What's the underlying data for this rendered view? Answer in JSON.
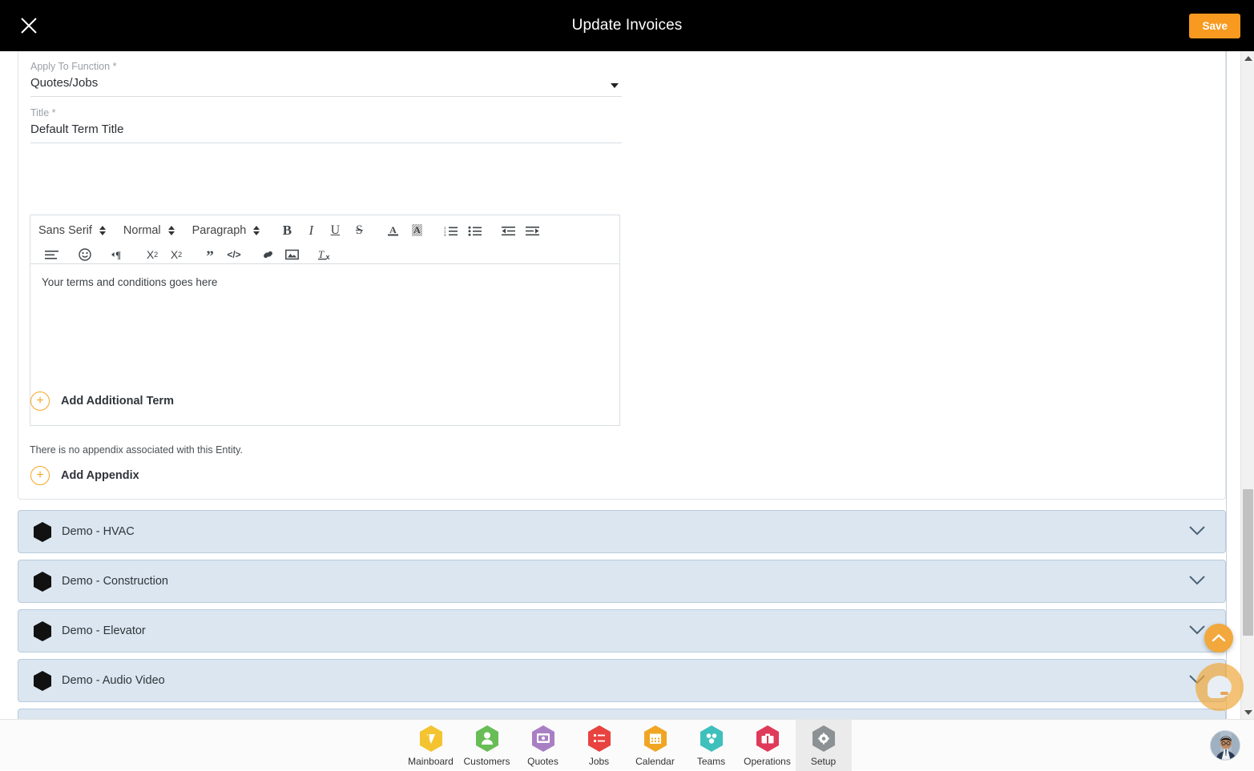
{
  "topbar": {
    "title": "Update Invoices",
    "close_label": "Close",
    "save_label": "Save"
  },
  "form": {
    "apply_to_function": {
      "label": "Apply To Function *",
      "value": "Quotes/Jobs"
    },
    "title_field": {
      "label": "Title *",
      "value": "Default Term Title"
    }
  },
  "editor": {
    "font_family": "Sans Serif",
    "font_size": "Normal",
    "block_format": "Paragraph",
    "content": "Your terms and conditions goes here",
    "tools_row1": [
      {
        "name": "bold-icon",
        "glyph": "B"
      },
      {
        "name": "italic-icon",
        "glyph": "I"
      },
      {
        "name": "underline-icon",
        "glyph": "U"
      },
      {
        "name": "strikethrough-icon",
        "glyph": "S"
      },
      {
        "name": "text-color-icon",
        "glyph": "A"
      },
      {
        "name": "background-color-icon",
        "glyph": "A"
      },
      {
        "name": "ordered-list-icon",
        "glyph": "1."
      },
      {
        "name": "bullet-list-icon",
        "glyph": "•"
      },
      {
        "name": "outdent-icon",
        "glyph": "⇤"
      },
      {
        "name": "indent-icon",
        "glyph": "⇥"
      }
    ],
    "tools_row2": [
      {
        "name": "align-icon",
        "glyph": "≡"
      },
      {
        "name": "emoji-icon",
        "glyph": "☺"
      },
      {
        "name": "text-direction-icon",
        "glyph": "¶"
      },
      {
        "name": "subscript-icon",
        "glyph": "X₂"
      },
      {
        "name": "superscript-icon",
        "glyph": "X²"
      },
      {
        "name": "blockquote-icon",
        "glyph": "”"
      },
      {
        "name": "code-block-icon",
        "glyph": "</>"
      },
      {
        "name": "link-icon",
        "glyph": "ὑ7"
      },
      {
        "name": "image-icon",
        "glyph": "ὛC"
      },
      {
        "name": "clear-formatting-icon",
        "glyph": "Tx"
      }
    ]
  },
  "actions": {
    "add_additional_term": "Add Additional Term",
    "appendix_note": "There is no appendix associated with this Entity.",
    "add_appendix": "Add Appendix"
  },
  "accordions": [
    {
      "label": "Demo - HVAC"
    },
    {
      "label": "Demo - Construction"
    },
    {
      "label": "Demo - Elevator"
    },
    {
      "label": "Demo - Audio Video"
    },
    {
      "label": ""
    }
  ],
  "fab": {
    "scroll_top": "Scroll to top",
    "chat": "Open chat"
  },
  "bottom_nav": {
    "items": [
      {
        "label": "Mainboard",
        "icon": "mainboard-icon",
        "color": "#f4c430",
        "active": false
      },
      {
        "label": "Customers",
        "icon": "customers-icon",
        "color": "#68bd57",
        "active": false
      },
      {
        "label": "Quotes",
        "icon": "quotes-icon",
        "color": "#a97fc4",
        "active": false
      },
      {
        "label": "Jobs",
        "icon": "jobs-icon",
        "color": "#e8433f",
        "active": false
      },
      {
        "label": "Calendar",
        "icon": "calendar-icon",
        "color": "#f0a623",
        "active": false
      },
      {
        "label": "Teams",
        "icon": "teams-icon",
        "color": "#3fc0bd",
        "active": false
      },
      {
        "label": "Operations",
        "icon": "operations-icon",
        "color": "#e03a5a",
        "active": false
      },
      {
        "label": "Setup",
        "icon": "setup-icon",
        "color": "#8c9194",
        "active": true
      }
    ],
    "avatar_label": "User profile"
  },
  "colors": {
    "accent_orange": "#f79a1f",
    "accordion_bg": "#dbe6f0",
    "accordion_border": "#b8ccdd",
    "topbar_bg": "#000000"
  }
}
